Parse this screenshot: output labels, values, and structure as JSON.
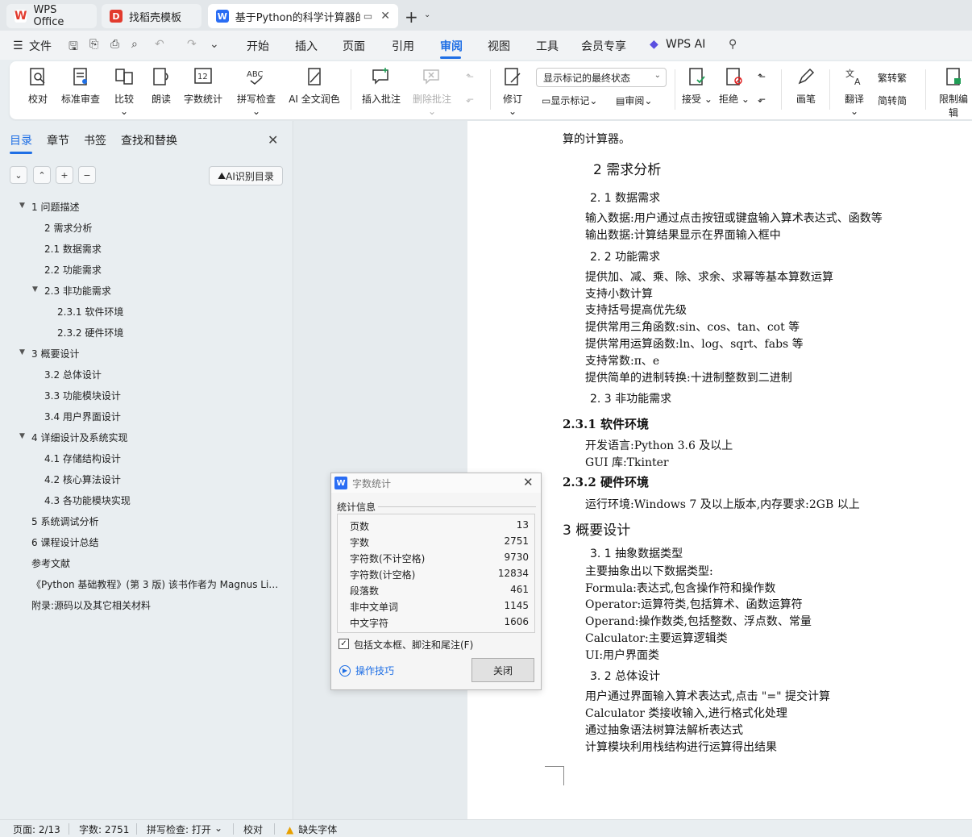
{
  "tabs": {
    "wps": "WPS Office",
    "templates": "找稻壳模板",
    "doc": "基于Python的科学计算器的实"
  },
  "menu": {
    "file": "文件",
    "items": [
      "开始",
      "插入",
      "页面",
      "引用",
      "审阅",
      "视图",
      "工具",
      "会员专享"
    ],
    "active": "审阅",
    "wps_ai": "WPS AI"
  },
  "ribbon": {
    "proofread": "校对",
    "std_review": "标准审查",
    "compare": "比较",
    "read_aloud": "朗读",
    "word_count": "字数统计",
    "spell_check": "拼写检查",
    "ai_polish": "AI 全文润色",
    "insert_comment": "插入批注",
    "delete_comment": "删除批注",
    "track_changes": "修订",
    "markup_state": "显示标记的最终状态",
    "show_markup": "显示标记",
    "review": "审阅",
    "accept": "接受",
    "reject": "拒绝",
    "ink": "画笔",
    "translate": "翻译",
    "to_traditional": "转繁",
    "to_simplified": "转简",
    "restrict_edit": "限制编辑"
  },
  "nav": {
    "tabs": [
      "目录",
      "章节",
      "书签",
      "查找和替换"
    ],
    "ai_toc": "AI识别目录",
    "toc": [
      {
        "label": "1  问题描述",
        "level": 0,
        "expanded": true
      },
      {
        "label": "2  需求分析",
        "level": 1
      },
      {
        "label": "2.1  数据需求",
        "level": 1
      },
      {
        "label": "2.2  功能需求",
        "level": 1
      },
      {
        "label": "2.3  非功能需求",
        "level": 1,
        "expanded": true
      },
      {
        "label": "2.3.1 软件环境",
        "level": 2
      },
      {
        "label": "2.3.2 硬件环境",
        "level": 2
      },
      {
        "label": "3  概要设计",
        "level": 0,
        "expanded": true
      },
      {
        "label": "3.2  总体设计",
        "level": 1
      },
      {
        "label": "3.3  功能模块设计",
        "level": 1
      },
      {
        "label": "3.4  用户界面设计",
        "level": 1
      },
      {
        "label": "4  详细设计及系统实现",
        "level": 0,
        "expanded": true
      },
      {
        "label": "4.1  存储结构设计",
        "level": 1
      },
      {
        "label": "4.2  核心算法设计",
        "level": 1
      },
      {
        "label": "4.3  各功能模块实现",
        "level": 1
      },
      {
        "label": "5  系统调试分析",
        "level": 0
      },
      {
        "label": "6  课程设计总结",
        "level": 0
      },
      {
        "label": "参考文献",
        "level": 0
      },
      {
        "label": "《Python 基础教程》(第 3 版) 该书作者为 Magnus Li…",
        "level": 0
      },
      {
        "label": "附录:源码以及其它相关材料",
        "level": 0
      }
    ]
  },
  "doc": {
    "top_line": "算的计算器。",
    "h2": "2  需求分析",
    "h21": "2. 1  数据需求",
    "l1": "输入数据:用户通过点击按钮或键盘输入算术表达式、函数等",
    "l2": "输出数据:计算结果显示在界面输入框中",
    "h22": "2. 2  功能需求",
    "l3": "提供加、减、乘、除、求余、求幂等基本算数运算",
    "l4": "支持小数计算",
    "l5": "支持括号提高优先级",
    "l6": "提供常用三角函数:sin、cos、tan、cot 等",
    "l7": "提供常用运算函数:ln、log、sqrt、fabs 等",
    "l8": "支持常数:π、e",
    "l9": "提供简单的进制转换:十进制整数到二进制",
    "h23": "2. 3  非功能需求",
    "h231": "2.3.1 软件环境",
    "l10": "开发语言:Python 3.6 及以上",
    "l11": "GUI 库:Tkinter",
    "h232": "2.3.2 硬件环境",
    "l12": "运行环境:Windows 7 及以上版本,内存要求:2GB 以上",
    "h3": "3  概要设计",
    "h31": "3. 1 抽象数据类型",
    "l13": "主要抽象出以下数据类型:",
    "l14": "Formula:表达式,包含操作符和操作数",
    "l15": "Operator:运算符类,包括算术、函数运算符",
    "l16": "Operand:操作数类,包括整数、浮点数、常量",
    "l17": "Calculator:主要运算逻辑类",
    "l18": "UI:用户界面类",
    "h32": "3. 2  总体设计",
    "l19": "用户通过界面输入算术表达式,点击 \"=\" 提交计算",
    "l20": "Calculator 类接收输入,进行格式化处理",
    "l21": "通过抽象语法树算法解析表达式",
    "l22": "计算模块利用栈结构进行运算得出结果"
  },
  "dialog": {
    "title": "字数统计",
    "section": "统计信息",
    "stats": [
      {
        "label": "页数",
        "value": "13"
      },
      {
        "label": "字数",
        "value": "2751"
      },
      {
        "label": "字符数(不计空格)",
        "value": "9730"
      },
      {
        "label": "字符数(计空格)",
        "value": "12834"
      },
      {
        "label": "段落数",
        "value": "461"
      },
      {
        "label": "非中文单词",
        "value": "1145"
      },
      {
        "label": "中文字符",
        "value": "1606"
      }
    ],
    "include_label": "包括文本框、脚注和尾注(F)",
    "include_checked": true,
    "tips": "操作技巧",
    "close": "关闭"
  },
  "status": {
    "page": "页面: 2/13",
    "words": "字数: 2751",
    "spell": "拼写检查: 打开",
    "proof": "校对",
    "missing_font": "缺失字体"
  },
  "colors": {
    "accent": "#1f6fe5",
    "wps_red": "#e23b2e"
  }
}
